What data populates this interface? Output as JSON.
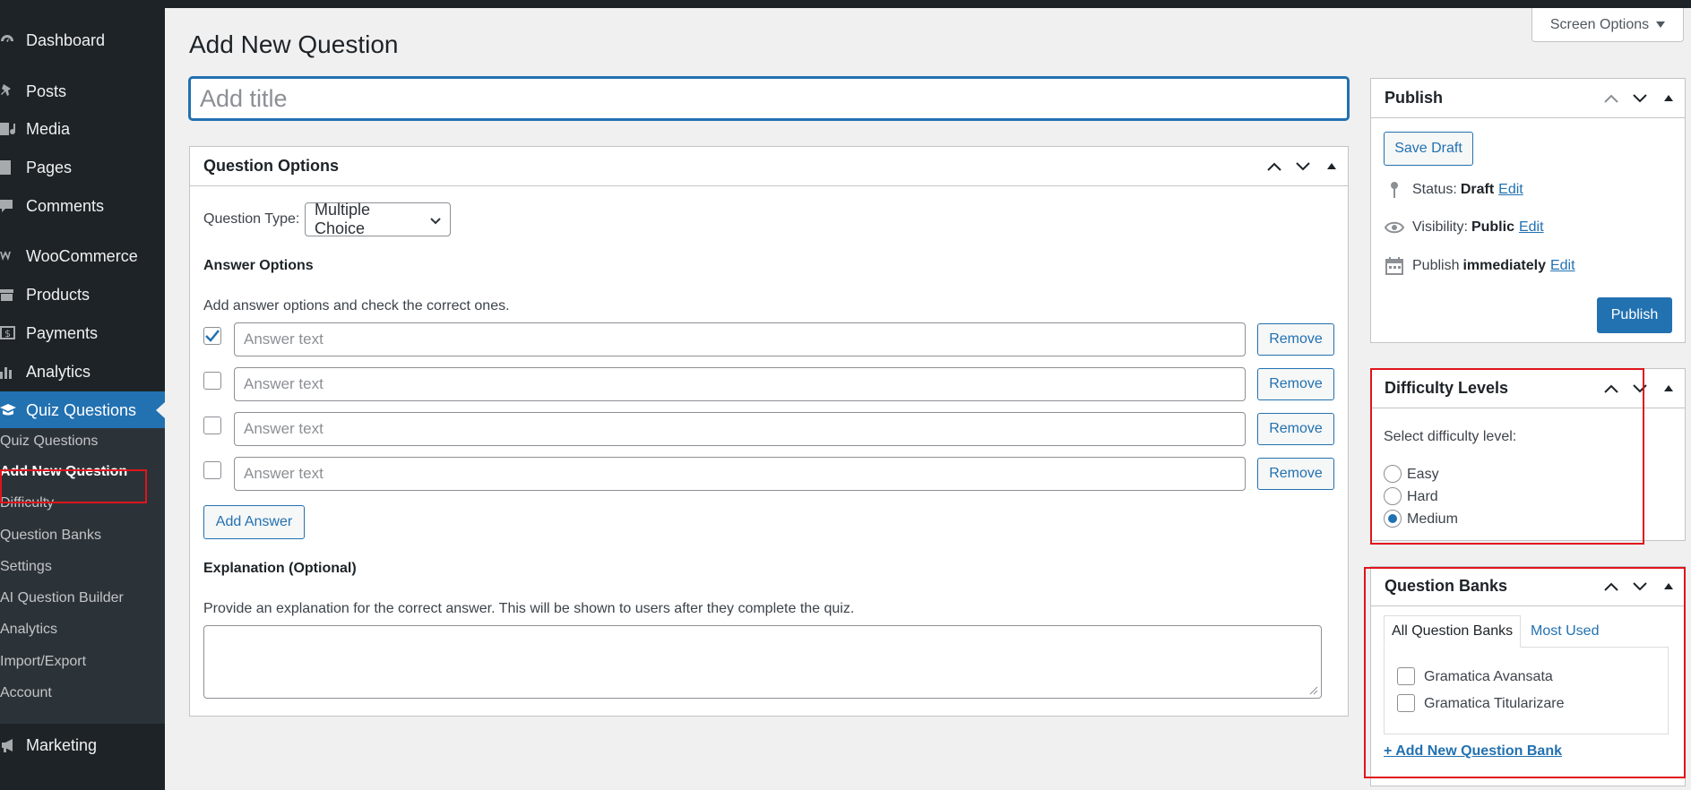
{
  "sidebar": {
    "items": [
      {
        "label": "Dashboard",
        "icon": "dashboard-icon"
      },
      {
        "label": "Posts",
        "icon": "pin-icon"
      },
      {
        "label": "Media",
        "icon": "media-icon"
      },
      {
        "label": "Pages",
        "icon": "pages-icon"
      },
      {
        "label": "Comments",
        "icon": "comment-icon"
      },
      {
        "label": "WooCommerce",
        "icon": "woocommerce-icon"
      },
      {
        "label": "Products",
        "icon": "archive-icon"
      },
      {
        "label": "Payments",
        "icon": "dollar-icon"
      },
      {
        "label": "Analytics",
        "icon": "bar-chart-icon"
      },
      {
        "label": "Quiz Questions",
        "icon": "graduation-cap-icon"
      },
      {
        "label": "Marketing",
        "icon": "megaphone-icon"
      }
    ],
    "submenu": [
      "Quiz Questions",
      "Add New Question",
      "Difficulty",
      "Question Banks",
      "Settings",
      "AI Question Builder",
      "Analytics",
      "Import/Export",
      "Account"
    ]
  },
  "screen_options": "Screen Options",
  "page_title": "Add New Question",
  "title_placeholder": "Add title",
  "question_options": {
    "title": "Question Options",
    "type_label": "Question Type:",
    "type_value": "Multiple Choice",
    "answer_options_title": "Answer Options",
    "answer_help": "Add answer options and check the correct ones.",
    "answers": [
      {
        "placeholder": "Answer text",
        "checked": true,
        "remove": "Remove"
      },
      {
        "placeholder": "Answer text",
        "checked": false,
        "remove": "Remove"
      },
      {
        "placeholder": "Answer text",
        "checked": false,
        "remove": "Remove"
      },
      {
        "placeholder": "Answer text",
        "checked": false,
        "remove": "Remove"
      }
    ],
    "add_answer": "Add Answer",
    "explanation_title": "Explanation (Optional)",
    "explanation_help": "Provide an explanation for the correct answer. This will be shown to users after they complete the quiz."
  },
  "publish": {
    "title": "Publish",
    "save_draft": "Save Draft",
    "status_label": "Status:",
    "status_value": "Draft",
    "visibility_label": "Visibility:",
    "visibility_value": "Public",
    "publish_label": "Publish",
    "publish_value": "immediately",
    "edit": "Edit",
    "publish_button": "Publish"
  },
  "difficulty": {
    "title": "Difficulty Levels",
    "prompt": "Select difficulty level:",
    "options": [
      "Easy",
      "Hard",
      "Medium"
    ],
    "selected": "Medium"
  },
  "question_banks": {
    "title": "Question Banks",
    "tabs": [
      "All Question Banks",
      "Most Used"
    ],
    "banks": [
      "Gramatica Avansata",
      "Gramatica Titularizare"
    ],
    "add_new": "+ Add New Question Bank"
  },
  "colors": {
    "accent": "#2271b1",
    "sidebar": "#1d2327",
    "annotation": "#e0141c"
  }
}
